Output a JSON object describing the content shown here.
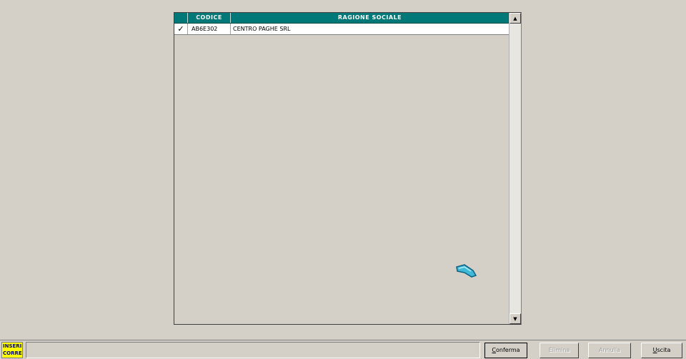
{
  "grid": {
    "columns": {
      "code": "CODICE",
      "name": "RAGIONE SOCIALE"
    },
    "rows": [
      {
        "checked": "✓",
        "code": "AB6E302",
        "name": "CENTRO PAGHE SRL"
      }
    ]
  },
  "status": {
    "mode_line1": "INSERIMENTO",
    "mode_line2": "CORRENTE"
  },
  "buttons": {
    "confirm": {
      "mnemonic": "C",
      "rest": "onferma"
    },
    "delete": {
      "label": "Elimina"
    },
    "cancel": {
      "label": "Annulla"
    },
    "exit": {
      "mnemonic": "U",
      "rest": "scita"
    }
  },
  "colors": {
    "header_bg": "#007878",
    "window_bg": "#d4d0c8",
    "mode_badge_bg": "#ffff00"
  }
}
